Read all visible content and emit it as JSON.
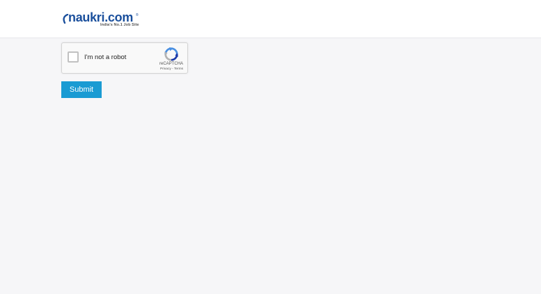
{
  "header": {
    "logo": {
      "brand_name": "naukri.com",
      "tagline": "India's No.1 Job Site",
      "brand_color": "#1a4f9c"
    }
  },
  "recaptcha": {
    "checkbox_label": "I'm not a robot",
    "checked": false,
    "brand": "reCAPTCHA",
    "privacy_label": "Privacy",
    "separator": " - ",
    "terms_label": "Terms",
    "icon": "recaptcha-logo-icon"
  },
  "form": {
    "submit_label": "Submit",
    "submit_color": "#1a9bd3"
  }
}
